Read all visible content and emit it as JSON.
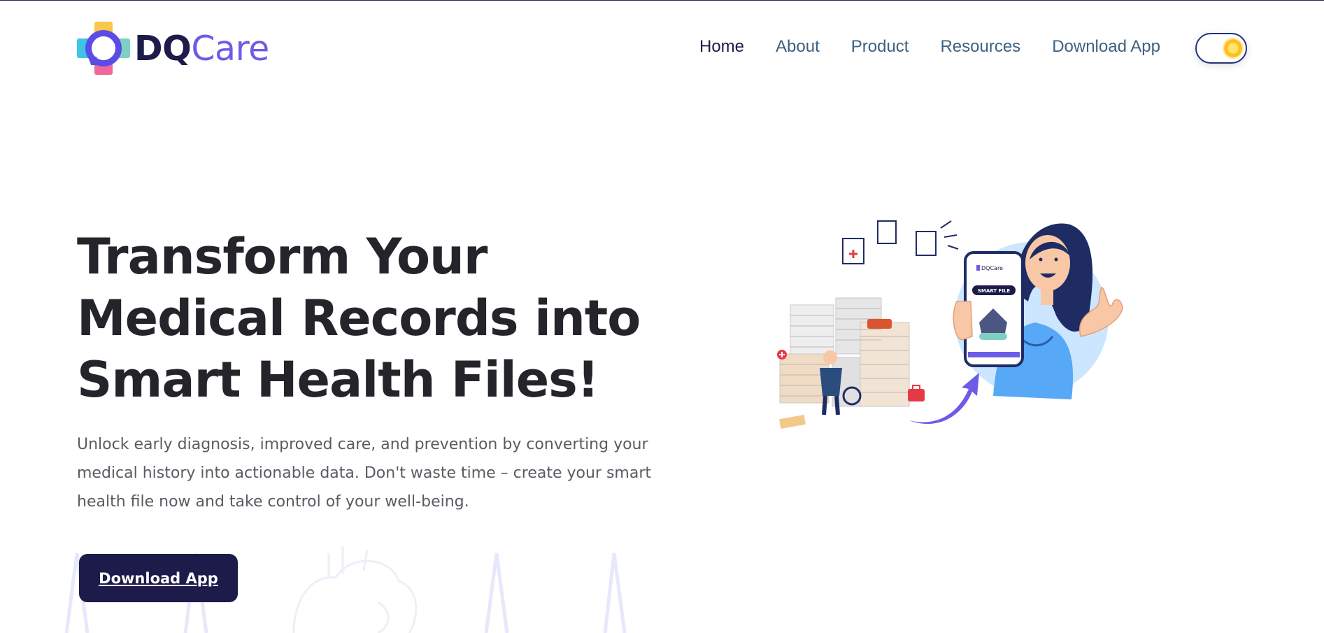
{
  "brand": {
    "logo_part1": "DQ",
    "logo_part2": "Care",
    "phone_logo": "DQCare"
  },
  "nav": {
    "items": [
      {
        "label": "Home",
        "active": true
      },
      {
        "label": "About",
        "active": false
      },
      {
        "label": "Product",
        "active": false
      },
      {
        "label": "Resources",
        "active": false
      },
      {
        "label": "Download App",
        "active": false
      }
    ],
    "theme_toggle_icon": "sun-icon"
  },
  "hero": {
    "title": "Transform Your Medical Records into Smart Health Files!",
    "subtitle": "Unlock early diagnosis, improved care, and prevention by converting your medical history into actionable data. Don't waste time – create your smart health file now and take control of your well-being.",
    "cta_label": "Download App"
  },
  "illustration": {
    "phone_badge": "SMART FILE"
  },
  "colors": {
    "primary": "#1c1b4a",
    "accent": "#6c5ce7",
    "nav_text": "#3f6180",
    "heading": "#24252a"
  }
}
